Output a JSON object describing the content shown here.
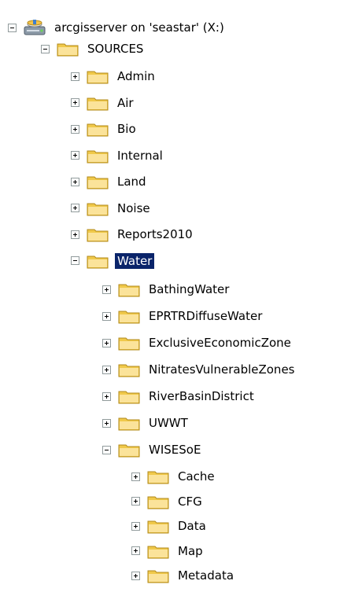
{
  "tree": {
    "root": {
      "label": "arcgisserver on 'seastar' (X:)",
      "icon": "server-drive-icon",
      "expanded": true
    },
    "sources": {
      "label": "SOURCES",
      "icon": "folder-icon",
      "expanded": true
    },
    "sources_children": [
      {
        "label": "Admin",
        "expanded": false
      },
      {
        "label": "Air",
        "expanded": false
      },
      {
        "label": "Bio",
        "expanded": false
      },
      {
        "label": "Internal",
        "expanded": false
      },
      {
        "label": "Land",
        "expanded": false
      },
      {
        "label": "Noise",
        "expanded": false
      },
      {
        "label": "Reports2010",
        "expanded": false
      },
      {
        "label": "Water",
        "expanded": true,
        "selected": true
      }
    ],
    "water_children": [
      {
        "label": "BathingWater",
        "expanded": false
      },
      {
        "label": "EPRTRDiffuseWater",
        "expanded": false
      },
      {
        "label": "ExclusiveEconomicZone",
        "expanded": false
      },
      {
        "label": "NitratesVulnerableZones",
        "expanded": false
      },
      {
        "label": "RiverBasinDistrict",
        "expanded": false
      },
      {
        "label": "UWWT",
        "expanded": false
      },
      {
        "label": "WISESoE",
        "expanded": true
      }
    ],
    "wisesoe_children": [
      {
        "label": "Cache",
        "expanded": false
      },
      {
        "label": "CFG",
        "expanded": false
      },
      {
        "label": "Data",
        "expanded": false
      },
      {
        "label": "Map",
        "expanded": false
      },
      {
        "label": "Metadata",
        "expanded": false
      }
    ]
  },
  "colors": {
    "selection": "#0a246a",
    "folder": "#f0c94a",
    "expander_border": "#919b9c"
  }
}
